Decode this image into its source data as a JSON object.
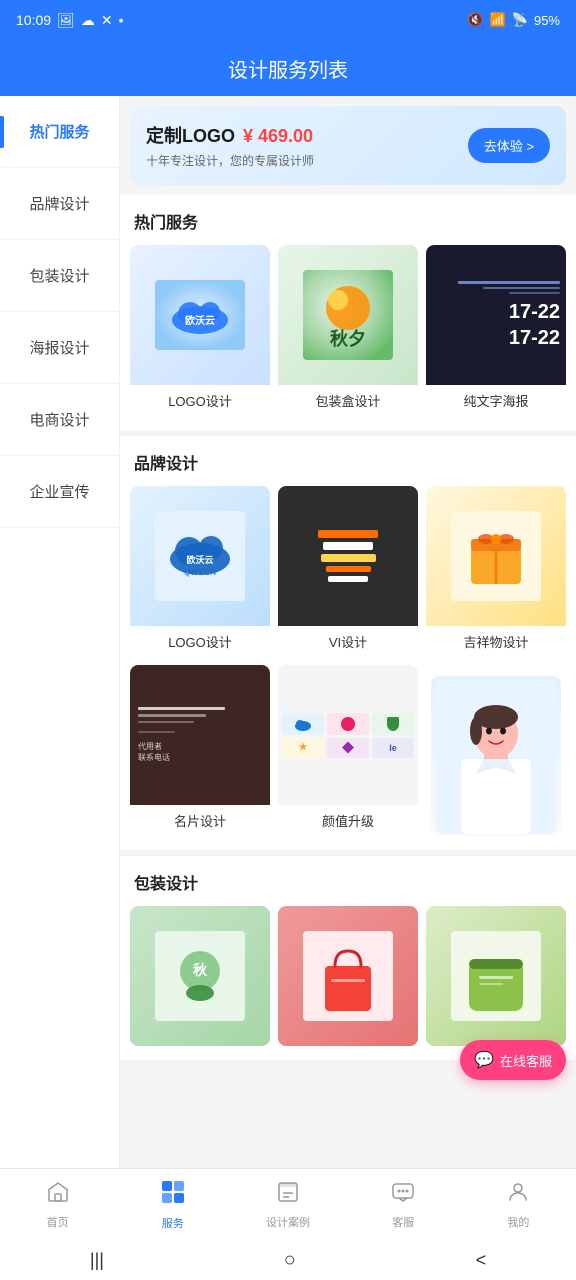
{
  "status": {
    "time": "10:09",
    "battery": "95%"
  },
  "header": {
    "title": "设计服务列表"
  },
  "banner": {
    "title": "定制LOGO",
    "price": "¥ 469.00",
    "subtitle": "十年专注设计，您的专属设计师",
    "btn_label": "去体验 >"
  },
  "sidebar": {
    "items": [
      {
        "id": "hot",
        "label": "热门服务",
        "active": true
      },
      {
        "id": "brand",
        "label": "品牌设计",
        "active": false
      },
      {
        "id": "packaging",
        "label": "包装设计",
        "active": false
      },
      {
        "id": "poster",
        "label": "海报设计",
        "active": false
      },
      {
        "id": "ecommerce",
        "label": "电商设计",
        "active": false
      },
      {
        "id": "corporate",
        "label": "企业宣传",
        "active": false
      }
    ]
  },
  "sections": {
    "hot": {
      "title": "热门服务",
      "items": [
        {
          "id": "logo-hot",
          "label": "LOGO设计"
        },
        {
          "id": "pkg-box-hot",
          "label": "包装盒设计"
        },
        {
          "id": "text-poster-hot",
          "label": "纯文字海报"
        }
      ]
    },
    "brand": {
      "title": "品牌设计",
      "row1": [
        {
          "id": "logo-brand",
          "label": "LOGO设计"
        },
        {
          "id": "vi-brand",
          "label": "VI设计"
        },
        {
          "id": "mascot-brand",
          "label": "吉祥物设计"
        }
      ],
      "row2": [
        {
          "id": "card-brand",
          "label": "名片设计"
        },
        {
          "id": "value-brand",
          "label": "颜值升级"
        }
      ]
    },
    "packaging": {
      "title": "包装设计",
      "items": [
        {
          "id": "pkg1",
          "label": ""
        },
        {
          "id": "pkg2",
          "label": ""
        },
        {
          "id": "pkg3",
          "label": ""
        }
      ]
    }
  },
  "float_cs": {
    "label": "在线客服"
  },
  "bottom_nav": {
    "items": [
      {
        "id": "home",
        "label": "首页",
        "icon": "⌂",
        "active": false
      },
      {
        "id": "service",
        "label": "服务",
        "icon": "⊞",
        "active": true
      },
      {
        "id": "cases",
        "label": "设计案例",
        "icon": "📋",
        "active": false
      },
      {
        "id": "cs",
        "label": "客服",
        "icon": "💬",
        "active": false
      },
      {
        "id": "mine",
        "label": "我的",
        "icon": "☺",
        "active": false
      }
    ]
  }
}
